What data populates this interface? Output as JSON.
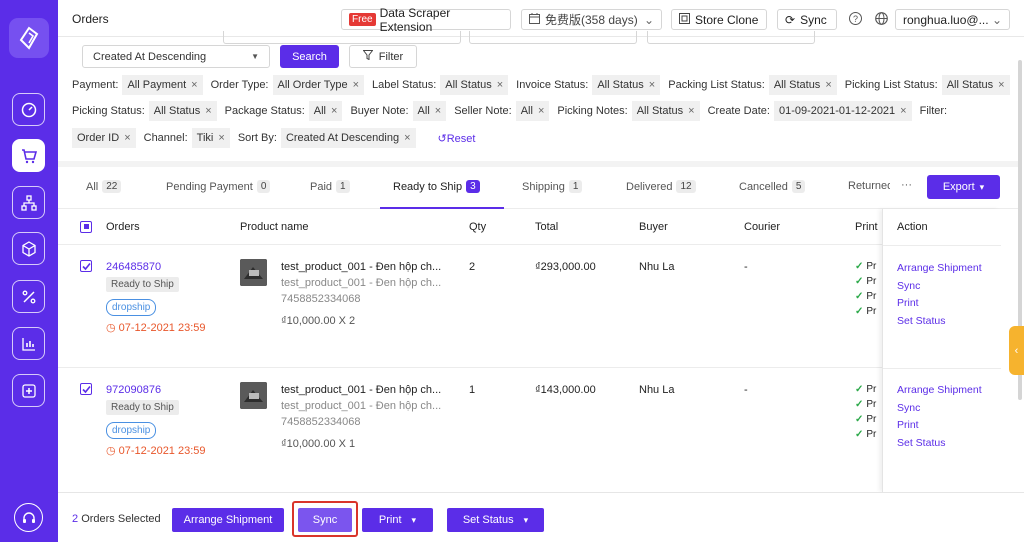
{
  "header": {
    "title": "Orders",
    "free_badge": "Free",
    "extension_label": "Data Scraper Extension",
    "plan_label": "免费版(358 days)",
    "store_clone_label": "Store Clone",
    "sync_label": "Sync",
    "user_label": "ronghua.luo@..."
  },
  "search_bar": {
    "sort_value": "Created At Descending",
    "search_label": "Search",
    "filter_label": "Filter"
  },
  "filter_rows": [
    [
      {
        "label": "Payment:",
        "value": "All Payment"
      },
      {
        "label": "Order Type:",
        "value": "All Order Type"
      },
      {
        "label": "Label Status:",
        "value": "All Status"
      },
      {
        "label": "Invoice Status:",
        "value": "All Status"
      },
      {
        "label": "Packing List Status:",
        "value": "All Status"
      },
      {
        "label": "Picking List Status:",
        "value": "All Status"
      }
    ],
    [
      {
        "label": "Picking Status:",
        "value": "All Status"
      },
      {
        "label": "Package Status:",
        "value": "All"
      },
      {
        "label": "Buyer Note:",
        "value": "All"
      },
      {
        "label": "Seller Note:",
        "value": "All"
      },
      {
        "label": "Picking Notes:",
        "value": "All Status"
      },
      {
        "label": "Create Date:",
        "value": "01-09-2021-01-12-2021"
      },
      {
        "label": "Filter:",
        "value": ""
      }
    ],
    [
      {
        "label": "",
        "value": "Order ID"
      },
      {
        "label": "Channel:",
        "value": "Tiki"
      },
      {
        "label": "Sort By:",
        "value": "Created At Descending"
      }
    ]
  ],
  "reset_label": "Reset",
  "tabs": [
    {
      "label": "All",
      "count": "22"
    },
    {
      "label": "Pending Payment",
      "count": "0"
    },
    {
      "label": "Paid",
      "count": "1"
    },
    {
      "label": "Ready to Ship",
      "count": "3"
    },
    {
      "label": "Shipping",
      "count": "1"
    },
    {
      "label": "Delivered",
      "count": "12"
    },
    {
      "label": "Cancelled",
      "count": "5"
    },
    {
      "label": "Returned",
      "count": ""
    }
  ],
  "more_label": "···",
  "export_label": "Export",
  "columns": {
    "orders": "Orders",
    "product": "Product name",
    "qty": "Qty",
    "total": "Total",
    "buyer": "Buyer",
    "courier": "Courier",
    "print": "Print",
    "action": "Action"
  },
  "orders": [
    {
      "id": "246485870",
      "status": "Ready to Ship",
      "type": "dropship",
      "date": "07-12-2021 23:59",
      "product_name": "test_product_001 - Đen hộp ch...",
      "product_variant": "test_product_001 - Đen hộp ch...",
      "sku": "7458852334068",
      "unit_price": "₫10,000.00 X 2",
      "qty": "2",
      "total": "₫293,000.00",
      "buyer": "Nhu La",
      "courier": "-",
      "print_items": [
        "Pr",
        "Pr",
        "Pr",
        "Pr"
      ]
    },
    {
      "id": "972090876",
      "status": "Ready to Ship",
      "type": "dropship",
      "date": "07-12-2021 23:59",
      "product_name": "test_product_001 - Đen hộp ch...",
      "product_variant": "test_product_001 - Đen hộp ch...",
      "sku": "7458852334068",
      "unit_price": "₫10,000.00 X 1",
      "qty": "1",
      "total": "₫143,000.00",
      "buyer": "Nhu La",
      "courier": "-",
      "print_items": [
        "Pr",
        "Pr",
        "Pr",
        "Pr"
      ]
    }
  ],
  "actions": [
    "Arrange Shipment",
    "Sync",
    "Print",
    "Set Status"
  ],
  "bottom_bar": {
    "selected_count": "2",
    "selected_text": "Orders Selected",
    "arrange_label": "Arrange Shipment",
    "sync_label": "Sync",
    "print_label": "Print",
    "set_status_label": "Set Status"
  },
  "colors": {
    "primary": "#5b2de8",
    "warning": "#e8572b",
    "success": "#2aa848",
    "handle": "#f6b32e"
  }
}
